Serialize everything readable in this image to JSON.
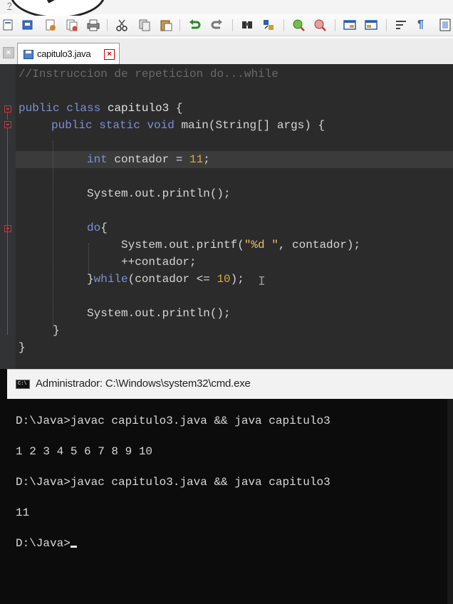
{
  "menu": {
    "mark": "?"
  },
  "toolbar": {
    "buttons": [
      "new-file-icon",
      "open-file-icon",
      "save-icon",
      "save-all-icon",
      "print-icon",
      "cut-icon",
      "copy-icon",
      "paste-icon",
      "undo-icon",
      "redo-icon",
      "find-icon",
      "replace-icon",
      "zoom-in-icon",
      "zoom-out-icon",
      "window-icon",
      "sync-icon",
      "wrap-icon",
      "pilcrow-icon",
      "monitor-icon"
    ]
  },
  "tab": {
    "filename": "capitulo3.java"
  },
  "code": {
    "comment": "//Instruccion de repeticion do...while",
    "kw_public": "public",
    "kw_class": "class",
    "class_name": "capitulo3",
    "open_brace": " {",
    "kw_static": "static",
    "kw_void": "void",
    "main_sig": "main(String[] args) {",
    "kw_int": "int",
    "decl_mid": "contador = ",
    "init_value": "11",
    "semicolon": ";",
    "println": "System.out.println();",
    "kw_do": "do",
    "do_brace": "{",
    "printf_start": "System.out.printf(",
    "printf_format": "\"%d \"",
    "printf_end": ", contador);",
    "increment": "++contador;",
    "close_brace": "}",
    "kw_while": "while",
    "while_mid": "(contador <= ",
    "limit_value": "10",
    "while_end": ");",
    "println2": "System.out.println();",
    "method_close": "}",
    "class_close": "}"
  },
  "cmd": {
    "title": "Administrador: C:\\Windows\\system32\\cmd.exe",
    "icon_text": "C:\\",
    "lines": [
      "D:\\Java>javac capitulo3.java && java capitulo3",
      "1 2 3 4 5 6 7 8 9 10",
      "D:\\Java>javac capitulo3.java && java capitulo3",
      "11"
    ],
    "prompt": "D:\\Java>"
  }
}
